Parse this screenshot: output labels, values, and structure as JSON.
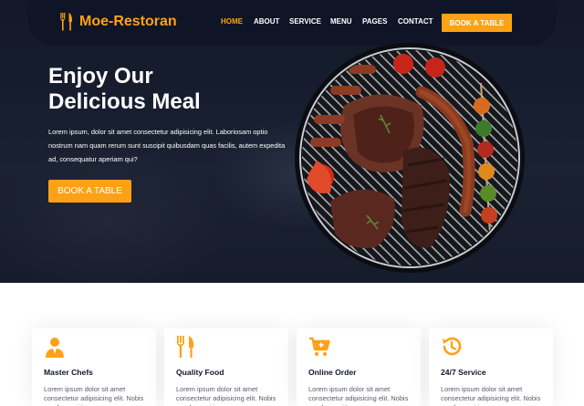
{
  "brand": {
    "name": "Moe-Restoran",
    "icon": "utensils-icon"
  },
  "nav": {
    "links": [
      "HOME",
      "ABOUT",
      "SERVICE",
      "MENU",
      "PAGES",
      "CONTACT"
    ],
    "active_index": 0,
    "cta_label": "BOOK A TABLE"
  },
  "hero": {
    "title_line1": "Enjoy Our",
    "title_line2": "Delicious Meal",
    "text": "Lorem ipsum, dolor sit amet consectetur adipisicing elit. Laboriosam optio nostrum nam quam rerum sunt suscipit quibusdam quas facilis, autem expedita ad, consequatur aperiam qui?",
    "button_label": "BOOK A TABLE",
    "image": "grilled-food-on-barbecue"
  },
  "services": [
    {
      "title": "Master Chefs",
      "icon": "chef-icon",
      "text": "Lorem ipsum dolor sit amet consectetur adipisicing elit. Nobis quod magni ipsam"
    },
    {
      "title": "Quality Food",
      "icon": "utensils-icon",
      "text": "Lorem ipsum dolor sit amet consectetur adipisicing elit. Nobis quod magni ipsam"
    },
    {
      "title": "Online Order",
      "icon": "cart-plus-icon",
      "text": "Lorem ipsum dolor sit amet consectetur adipisicing elit. Nobis quod magni ipsam"
    },
    {
      "title": "24/7 Service",
      "icon": "clock-icon",
      "text": "Lorem ipsum dolor sit amet consectetur adipisicing elit. Nobis quod magni ipsam"
    }
  ],
  "colors": {
    "accent": "#FEA116",
    "dark": "#0F172B"
  }
}
